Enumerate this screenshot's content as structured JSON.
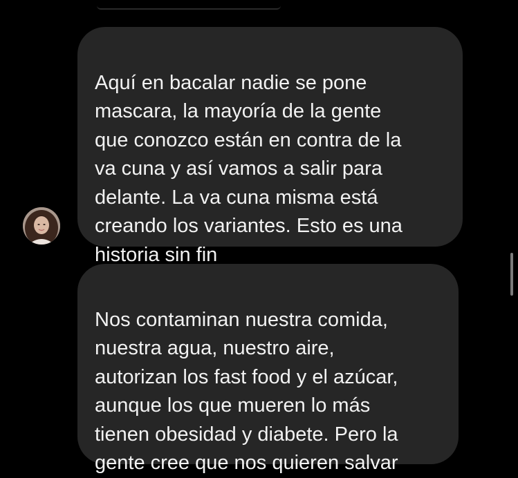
{
  "messages": [
    {
      "text": "Aquí en bacalar nadie se pone\nmascara, la mayoría de la gente\nque conozco están en contra de la\nva cuna y así vamos a salir para\ndelante. La va cuna misma está\ncreando los variantes. Esto es una\nhistoria sin fin"
    },
    {
      "text": "Nos contaminan nuestra comida,\nnuestra agua, nuestro aire,\nautorizan los fast food y el azúcar,\naunque los que mueren lo más\ntienen obesidad y diabete. Pero la\ngente cree que nos quieren salvar"
    }
  ],
  "colors": {
    "background": "#000000",
    "bubble": "#262626",
    "text": "#f2f2f2"
  },
  "icons": {
    "avatar": "profile-photo"
  }
}
